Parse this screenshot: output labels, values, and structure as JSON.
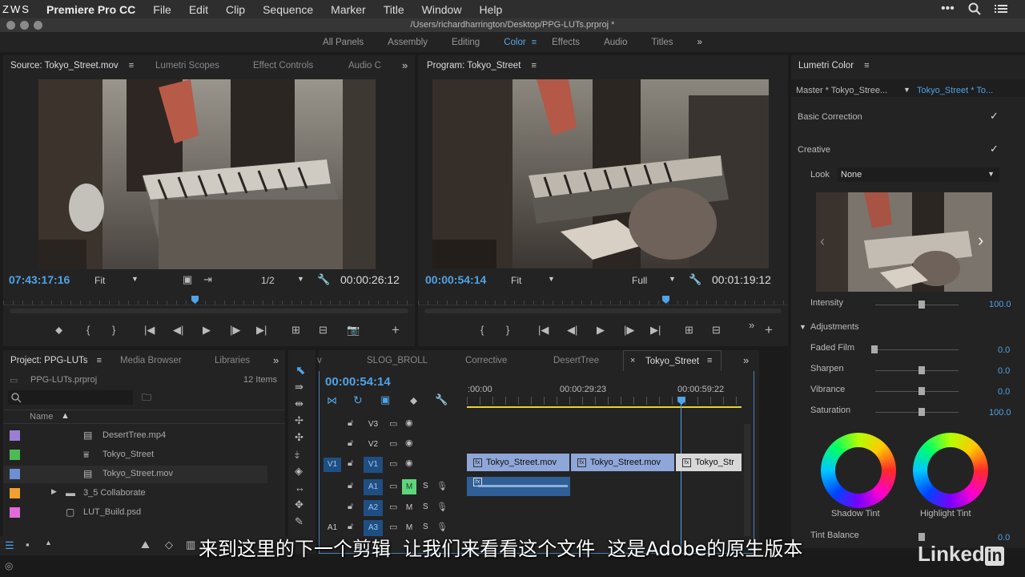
{
  "watermark": "ZWS",
  "menubar": {
    "app": "Premiere Pro CC",
    "items": [
      "File",
      "Edit",
      "Clip",
      "Sequence",
      "Marker",
      "Title",
      "Window",
      "Help"
    ],
    "right_icons": [
      "more-icon",
      "search-icon",
      "list-icon"
    ]
  },
  "window_title": "/Users/richardharrington/Desktop/PPG-LUTs.prproj *",
  "workspaces": {
    "items": [
      "All Panels",
      "Assembly",
      "Editing",
      "Color",
      "Effects",
      "Audio",
      "Titles"
    ],
    "active": "Color"
  },
  "source_monitor": {
    "tabs": [
      "Source: Tokyo_Street.mov",
      "Lumetri Scopes",
      "Effect Controls",
      "Audio C"
    ],
    "timecode": "07:43:17:16",
    "fit": "Fit",
    "resolution": "1/2",
    "duration": "00:00:26:12",
    "playhead_fraction": 0.47
  },
  "program_monitor": {
    "tab": "Program: Tokyo_Street",
    "timecode": "00:00:54:14",
    "fit": "Fit",
    "resolution": "Full",
    "duration": "00:01:19:12",
    "playhead_fraction": 0.69
  },
  "lumetri": {
    "title": "Lumetri Color",
    "master_label": "Master * Tokyo_Stree...",
    "clip_label": "Tokyo_Street * To...",
    "basic_correction": "Basic Correction",
    "creative": "Creative",
    "look_label": "Look",
    "look_value": "None",
    "intensity_label": "Intensity",
    "intensity_value": "100.0",
    "adjustments_label": "Adjustments",
    "adjustments": [
      {
        "name": "Faded Film",
        "value": "0.0",
        "level": 0.0
      },
      {
        "name": "Sharpen",
        "value": "0.0",
        "level": 0.5
      },
      {
        "name": "Vibrance",
        "value": "0.0",
        "level": 0.5
      },
      {
        "name": "Saturation",
        "value": "100.0",
        "level": 0.5
      }
    ],
    "shadow_tint": "Shadow Tint",
    "highlight_tint": "Highlight Tint",
    "tint_balance": "Tint Balance",
    "tint_balance_value": "0.0"
  },
  "project": {
    "tabs": [
      "Project: PPG-LUTs",
      "Media Browser",
      "Libraries"
    ],
    "file": "PPG-LUTs.prproj",
    "count": "12 Items",
    "column": "Name",
    "items": [
      {
        "name": "DesertTree.mp4",
        "color": "#9b7fd4",
        "icon": "video-clip-icon"
      },
      {
        "name": "Tokyo_Street",
        "color": "#4dbb55",
        "icon": "sequence-icon"
      },
      {
        "name": "Tokyo_Street.mov",
        "color": "#6d8fd6",
        "icon": "video-clip-icon"
      },
      {
        "name": "3_5 Collaborate",
        "color": "#f0a030",
        "icon": "folder-icon"
      },
      {
        "name": "LUT_Build.psd",
        "color": "#e36ad8",
        "icon": "file-icon"
      }
    ]
  },
  "timeline": {
    "tabs": [
      "v",
      "SLOG_BROLL",
      "Corrective",
      "DesertTree",
      "Tokyo_Street"
    ],
    "active_tab": "Tokyo_Street",
    "timecode": "00:00:54:14",
    "ruler": [
      ":00:00",
      "00:00:29:23",
      "00:00:59:22"
    ],
    "tracks": [
      {
        "label": "V3",
        "src": ""
      },
      {
        "label": "V2",
        "src": ""
      },
      {
        "label": "V1",
        "src": "V1"
      },
      {
        "label": "A1",
        "src": ""
      },
      {
        "label": "A2",
        "src": ""
      },
      {
        "label": "A3",
        "src": "A1"
      }
    ],
    "clips": [
      "Tokyo_Street.mov",
      "Tokyo_Street.mov",
      "Tokyo_Str"
    ]
  },
  "subtitle": "来到这里的下一个剪辑  让我们来看看这个文件  这是Adobe的原生版本",
  "linkedin": "Linked"
}
